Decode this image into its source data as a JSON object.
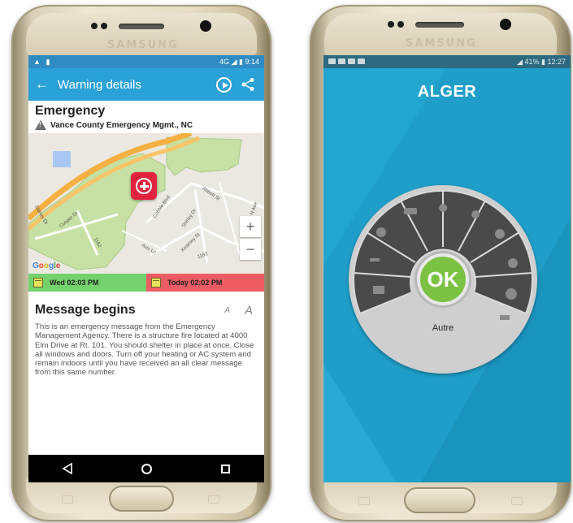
{
  "left_phone": {
    "brand": "SAMSUNG",
    "status_bar": {
      "time": "9:14",
      "network": "4G"
    },
    "app_bar": {
      "title": "Warning details",
      "back_icon": "arrow-left-icon",
      "play_icon": "play-circle-icon",
      "share_icon": "share-icon"
    },
    "alert": {
      "title": "Emergency",
      "source": "Vance County Emergency Mgmt., NC"
    },
    "map": {
      "attribution": "Google",
      "zoom_in": "+",
      "zoom_out": "−",
      "road_labels": [
        "Abbott St",
        "Cobble Blvd",
        "Shirley Dr",
        "Kearney St",
        "Avis Ln",
        "Cooper Dr",
        "Sidney Dr",
        "1162",
        "1163",
        "N Ave",
        "St"
      ]
    },
    "dates": {
      "start": "Wed 02:03 PM",
      "end": "Today 02:02 PM"
    },
    "message": {
      "title": "Message begins",
      "font_small": "A",
      "font_large": "A",
      "body": "This is an emergency message from the Emergency Management Agency. There is a structure fire located at 4000 Elm Drive at Rt. 101. You should shelter in place at once.  Close all windows and doors. Turn off your heating or AC system and remain indoors until you have received an all clear message from this same number."
    },
    "nav": {
      "back": "nav-back-icon",
      "home": "nav-home-icon",
      "recents": "nav-recents-icon"
    }
  },
  "right_phone": {
    "brand": "SAMSUNG",
    "status_bar": {
      "time": "12:27",
      "battery": "41%"
    },
    "city": "ALGER",
    "dial": {
      "ok_label": "OK",
      "selected_label": "Autre",
      "segments": [
        "car-icon",
        "location-pin-icon",
        "drop-icon",
        "gear-icon",
        "bug-icon",
        "cloud-icon",
        "plug-icon",
        "card-icon",
        "hammer-icon",
        "ball-icon"
      ]
    }
  },
  "colors": {
    "app_bar": "#2aa2d8",
    "start_date": "#73d26c",
    "end_date": "#ef5b63",
    "alger_bg": "#1e9ec8",
    "ok_green": "#7cc242"
  }
}
